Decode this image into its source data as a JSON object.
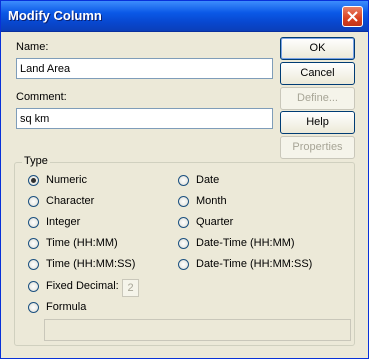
{
  "window": {
    "title": "Modify Column"
  },
  "fields": {
    "name_label": "Name:",
    "name_value": "Land Area",
    "comment_label": "Comment:",
    "comment_value": "sq km"
  },
  "buttons": {
    "ok": "OK",
    "cancel": "Cancel",
    "define": "Define...",
    "help": "Help",
    "properties": "Properties"
  },
  "type_group": {
    "title": "Type",
    "left": [
      {
        "label": "Numeric",
        "checked": true
      },
      {
        "label": "Character",
        "checked": false
      },
      {
        "label": "Integer",
        "checked": false
      },
      {
        "label": "Time (HH:MM)",
        "checked": false
      },
      {
        "label": "Time (HH:MM:SS)",
        "checked": false
      },
      {
        "label": "Fixed Decimal:",
        "checked": false
      },
      {
        "label": "Formula",
        "checked": false
      }
    ],
    "right": [
      {
        "label": "Date",
        "checked": false
      },
      {
        "label": "Month",
        "checked": false
      },
      {
        "label": "Quarter",
        "checked": false
      },
      {
        "label": "Date-Time (HH:MM)",
        "checked": false
      },
      {
        "label": "Date-Time (HH:MM:SS)",
        "checked": false
      }
    ],
    "fixed_decimal_value": "2"
  }
}
